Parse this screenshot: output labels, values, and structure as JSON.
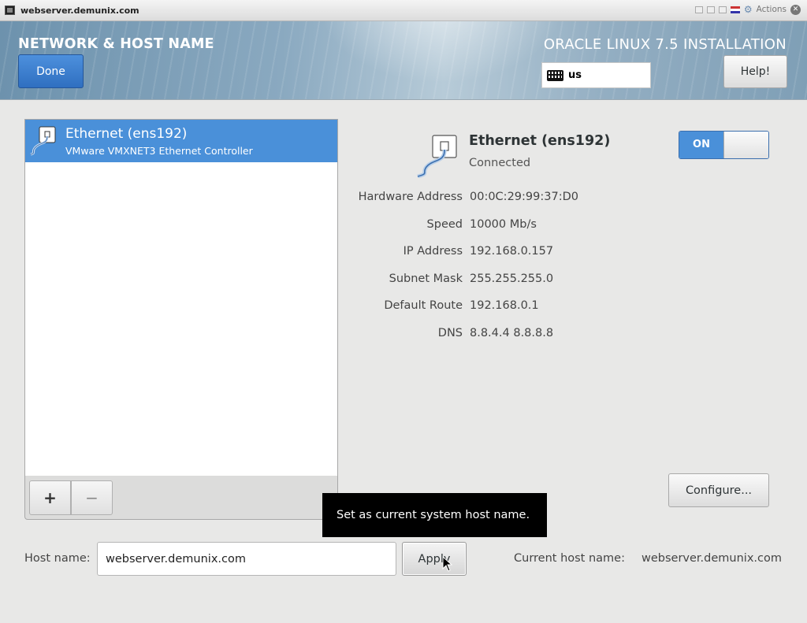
{
  "window": {
    "title": "webserver.demunix.com",
    "actions_label": "Actions"
  },
  "header": {
    "spoke_title": "NETWORK & HOST NAME",
    "product_title": "ORACLE LINUX 7.5 INSTALLATION",
    "done_label": "Done",
    "keyboard_layout": "us",
    "help_label": "Help!"
  },
  "devices": [
    {
      "name": "Ethernet (ens192)",
      "description": "VMware VMXNET3 Ethernet Controller",
      "selected": true
    }
  ],
  "list_toolbar": {
    "add_label": "+",
    "remove_label": "−"
  },
  "detail": {
    "name": "Ethernet (ens192)",
    "status": "Connected",
    "toggle_label": "ON",
    "properties": [
      {
        "label": "Hardware Address",
        "value": "00:0C:29:99:37:D0"
      },
      {
        "label": "Speed",
        "value": "10000 Mb/s"
      },
      {
        "label": "IP Address",
        "value": "192.168.0.157"
      },
      {
        "label": "Subnet Mask",
        "value": "255.255.255.0"
      },
      {
        "label": "Default Route",
        "value": "192.168.0.1"
      },
      {
        "label": "DNS",
        "value": "8.8.4.4 8.8.8.8"
      }
    ],
    "configure_label": "Configure..."
  },
  "hostname": {
    "label": "Host name:",
    "value": "webserver.demunix.com",
    "apply_label": "Apply",
    "current_label": "Current host name:",
    "current_value": "webserver.demunix.com",
    "tooltip": "Set as current system host name."
  },
  "colors": {
    "accent": "#4a90d9",
    "header": "#8aa9c0",
    "background": "#e8e8e7"
  }
}
